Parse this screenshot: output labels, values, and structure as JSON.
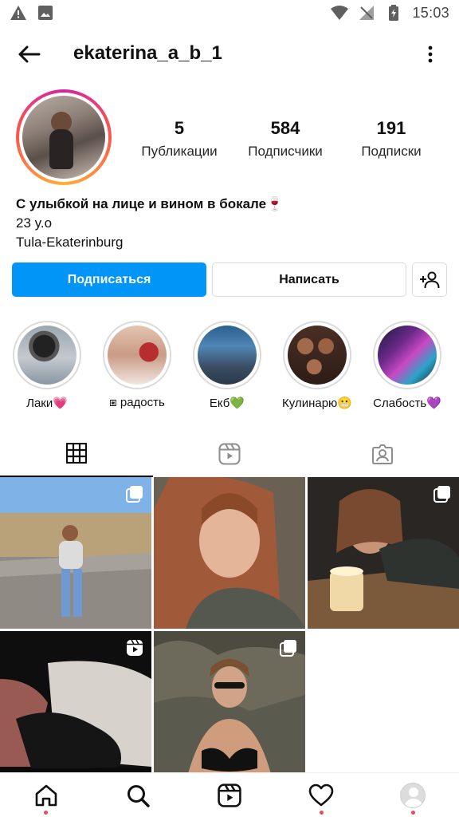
{
  "status_bar": {
    "time": "15:03",
    "icons": [
      "warning-icon",
      "image-icon",
      "wifi-icon",
      "no-signal-icon",
      "battery-icon"
    ]
  },
  "header": {
    "username": "ekaterina_a_b_1",
    "back_icon": "arrow-left-icon",
    "more_icon": "more-vertical-icon"
  },
  "profile": {
    "stats": [
      {
        "value": "5",
        "label": "Публикации"
      },
      {
        "value": "584",
        "label": "Подписчики"
      },
      {
        "value": "191",
        "label": "Подписки"
      }
    ],
    "bio": {
      "name": "С улыбкой на лице и вином в бокале🍷",
      "age": "23 y.o",
      "location": "Tula-Ekaterinburg"
    }
  },
  "actions": {
    "follow_label": "Подписаться",
    "message_label": "Написать",
    "suggest_icon": "add-person-icon"
  },
  "highlights": [
    {
      "label": "Лаки💗"
    },
    {
      "label": "⧆ радость"
    },
    {
      "label": "Екб💚"
    },
    {
      "label": "Кулинарю😬"
    },
    {
      "label": "Слабость💜"
    }
  ],
  "tabs": [
    {
      "name": "grid",
      "icon": "grid-icon",
      "active": true
    },
    {
      "name": "reels",
      "icon": "reels-icon",
      "active": false
    },
    {
      "name": "tagged",
      "icon": "tagged-icon",
      "active": false
    }
  ],
  "posts": [
    {
      "type": "carousel",
      "badge_icon": "multiple-photos-icon"
    },
    {
      "type": "photo"
    },
    {
      "type": "carousel",
      "badge_icon": "multiple-photos-icon"
    },
    {
      "type": "reel",
      "badge_icon": "reels-icon"
    },
    {
      "type": "carousel",
      "badge_icon": "multiple-photos-icon"
    }
  ],
  "bottom_nav": [
    {
      "name": "home",
      "icon": "home-icon",
      "dot": true
    },
    {
      "name": "search",
      "icon": "search-icon",
      "dot": false
    },
    {
      "name": "reels",
      "icon": "reels-icon",
      "dot": false
    },
    {
      "name": "activity",
      "icon": "heart-icon",
      "dot": true
    },
    {
      "name": "profile",
      "icon": "avatar-icon",
      "dot": true
    }
  ],
  "colors": {
    "primary_button": "#0095f6",
    "notification_dot": "#ed4956"
  }
}
